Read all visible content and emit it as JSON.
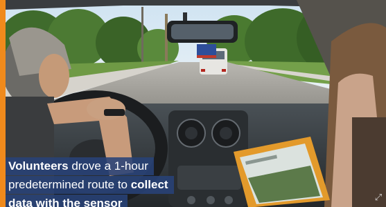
{
  "video": {
    "caption": {
      "line1": {
        "bold": "Volunteers",
        "text": " drove a 1-hour"
      },
      "line2": {
        "text": "predetermined route to ",
        "bold": "collect"
      },
      "line3": {
        "bold": "data with the sensor"
      }
    },
    "watermark_icon": "expand-icon"
  },
  "colors": {
    "accent": "#f08a1c",
    "caption_bg": "#284278",
    "caption_text": "#ffffff"
  }
}
